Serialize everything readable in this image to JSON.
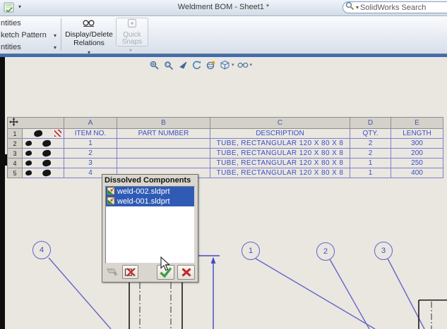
{
  "window": {
    "title": "Weldment BOM - Sheet1 *"
  },
  "search": {
    "placeholder": "SolidWorks Search"
  },
  "ribbon": {
    "left_labels": [
      "ntities",
      "ketch Pattern",
      "ntities"
    ],
    "display_delete_relations": {
      "line1": "Display/Delete",
      "line2": "Relations"
    },
    "quick_snaps": {
      "line1": "Quick",
      "line2": "Snaps"
    },
    "caret": "▾"
  },
  "view_toolbar": {
    "icons": [
      "zoom-to-fit-icon",
      "zoom-to-area-icon",
      "previous-view-icon",
      "rotate-view-icon",
      "3d-drawing-view-icon",
      "view-orientation-icon",
      "hide-show-items-icon"
    ]
  },
  "bom_table": {
    "column_letters": [
      "A",
      "B",
      "C",
      "D",
      "E"
    ],
    "row_numbers": [
      "1",
      "2",
      "3",
      "4",
      "5"
    ],
    "headers": [
      "ITEM NO.",
      "PART NUMBER",
      "DESCRIPTION",
      "QTY.",
      "LENGTH"
    ],
    "rows": [
      {
        "item_no": "1",
        "part_number": "",
        "description": "TUBE, RECTANGULAR 120 X 80 X 8",
        "qty": "2",
        "length": "300"
      },
      {
        "item_no": "2",
        "part_number": "",
        "description": "TUBE, RECTANGULAR 120 X 80 X 8",
        "qty": "2",
        "length": "200"
      },
      {
        "item_no": "3",
        "part_number": "",
        "description": "TUBE, RECTANGULAR 120 X 80 X 8",
        "qty": "1",
        "length": "250"
      },
      {
        "item_no": "4",
        "part_number": "",
        "description": "TUBE, RECTANGULAR 120 X 80 X 8",
        "qty": "1",
        "length": "400"
      }
    ]
  },
  "dialog": {
    "title": "Dissolved Components",
    "items": [
      {
        "name": "weld-002.sldprt"
      },
      {
        "name": "weld-001.sldprt"
      }
    ]
  },
  "balloons": [
    {
      "label": "4"
    },
    {
      "label": "1"
    },
    {
      "label": "2"
    },
    {
      "label": "3"
    }
  ],
  "colors": {
    "selection_blue": "#2f5bb5",
    "table_ink_blue": "#3c4ec4",
    "table_border_blue": "#8080cc",
    "annotation_blue": "#6464c8",
    "ribbon_strip_blue": "#3f6db0",
    "ok_green": "#3f9e3f",
    "cancel_red": "#c62828"
  }
}
